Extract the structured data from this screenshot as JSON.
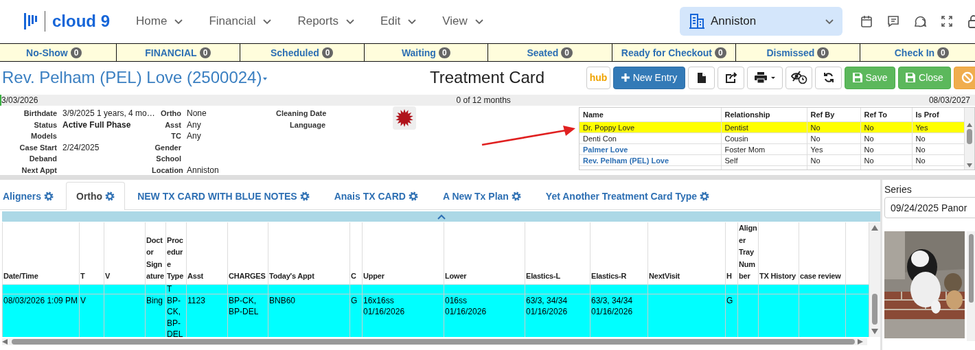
{
  "header": {
    "logo": "cloud 9",
    "nav": [
      "Home",
      "Financial",
      "Reports",
      "Edit",
      "View"
    ],
    "location": "Anniston"
  },
  "status_tabs": [
    {
      "label": "No-Show",
      "count": "0"
    },
    {
      "label": "FINANCIAL",
      "count": "0"
    },
    {
      "label": "Scheduled",
      "count": "0"
    },
    {
      "label": "Waiting",
      "count": "0"
    },
    {
      "label": "Seated",
      "count": "0"
    },
    {
      "label": "Ready for Checkout",
      "count": "0"
    },
    {
      "label": "Dismissed",
      "count": "0"
    },
    {
      "label": "Check In",
      "count": "0"
    }
  ],
  "patient": {
    "name": "Rev. Pelham (PEL) Love (2500024)",
    "page_title": "Treatment Card"
  },
  "toolbar": [
    {
      "kind": "hub",
      "label": "hub"
    },
    {
      "kind": "new",
      "label": "New Entry"
    },
    {
      "kind": "document"
    },
    {
      "kind": "share"
    },
    {
      "kind": "print"
    },
    {
      "kind": "hide-history"
    },
    {
      "kind": "refresh"
    },
    {
      "kind": "save",
      "label": "Save"
    },
    {
      "kind": "close",
      "label": "Close"
    },
    {
      "kind": "cancel"
    }
  ],
  "timeline": {
    "start": "3/03/2026",
    "progress": "0 of 12 months",
    "end": "08/03/2027"
  },
  "info_fields": [
    [
      {
        "label": "Birthdate",
        "value": "3/9/2025 1 years, 4 mo…",
        "bold": false
      },
      {
        "label": "Status",
        "value": "Active Full Phase",
        "bold": true
      },
      {
        "label": "Models"
      },
      {
        "label": "Case Start",
        "value": "2/24/2025",
        "bold": false
      },
      {
        "label": "Deband"
      },
      {
        "label": "Next Appt"
      }
    ],
    [
      {
        "label": "Ortho",
        "value": "None",
        "bold": false
      },
      {
        "label": "Asst",
        "value": "Any",
        "bold": false
      },
      {
        "label": "TC",
        "value": "Any",
        "bold": false
      },
      {
        "label": "Gender"
      },
      {
        "label": "School"
      },
      {
        "label": "Location",
        "value": "Anniston",
        "bold": false
      }
    ],
    [
      {
        "label": "Cleaning Date"
      },
      {
        "label": "Language"
      }
    ]
  ],
  "relationships": {
    "columns": [
      "Name",
      "Relationship",
      "Ref By",
      "Ref To",
      "Is Prof"
    ],
    "rows": [
      {
        "link": false,
        "selected": true,
        "cells": [
          "Dr. Poppy Love",
          "Dentist",
          "No",
          "No",
          "Yes"
        ]
      },
      {
        "link": false,
        "selected": false,
        "cells": [
          "Denti Con",
          "Cousin",
          "No",
          "No",
          "No"
        ]
      },
      {
        "link": true,
        "selected": false,
        "cells": [
          "Palmer Love",
          "Foster Mom",
          "Yes",
          "No",
          "No"
        ]
      },
      {
        "link": true,
        "selected": false,
        "cells": [
          "Rev. Pelham (PEL) Love",
          "Self",
          "No",
          "No",
          "No"
        ]
      }
    ]
  },
  "tabs": [
    {
      "label": "Aligners",
      "selected": false
    },
    {
      "label": "Ortho",
      "selected": true
    },
    {
      "label": "NEW TX CARD WITH BLUE NOTES",
      "selected": false
    },
    {
      "label": "Anais TX CARD",
      "selected": false
    },
    {
      "label": "A New Tx Plan",
      "selected": false
    },
    {
      "label": "Yet Another Treatment Card Type",
      "selected": false
    }
  ],
  "grid": {
    "columns": [
      "Date/Time",
      "T",
      "V",
      "Doctor Signature",
      "Procedure Type",
      "Asst",
      "CHARGES",
      "Today's Appt",
      "C",
      "Upper",
      "Lower",
      "Elastics-L",
      "Elastics-R",
      "NextVisit",
      "H",
      "Aligner Tray Number",
      "TX History",
      "case review"
    ],
    "rows": [
      [
        null,
        null,
        null,
        null,
        "T",
        null,
        null,
        null,
        null,
        null,
        null,
        null,
        null,
        null,
        null,
        null,
        null,
        null
      ],
      [
        "08/03/2026 1:09 PM",
        "V",
        null,
        "Bing",
        "BP-CK, BP-DEL",
        "1123",
        "BP-CK, BP-DEL",
        "BNB60",
        "G",
        "16x16ss\n01/16/2026",
        "016ss\n01/16/2026",
        "63/3, 34/34\n01/16/2026",
        "63/3, 34/34\n01/16/2026",
        null,
        "G",
        null,
        null,
        null
      ]
    ]
  },
  "series": {
    "label": "Series",
    "value": "09/24/2025 Panor"
  }
}
